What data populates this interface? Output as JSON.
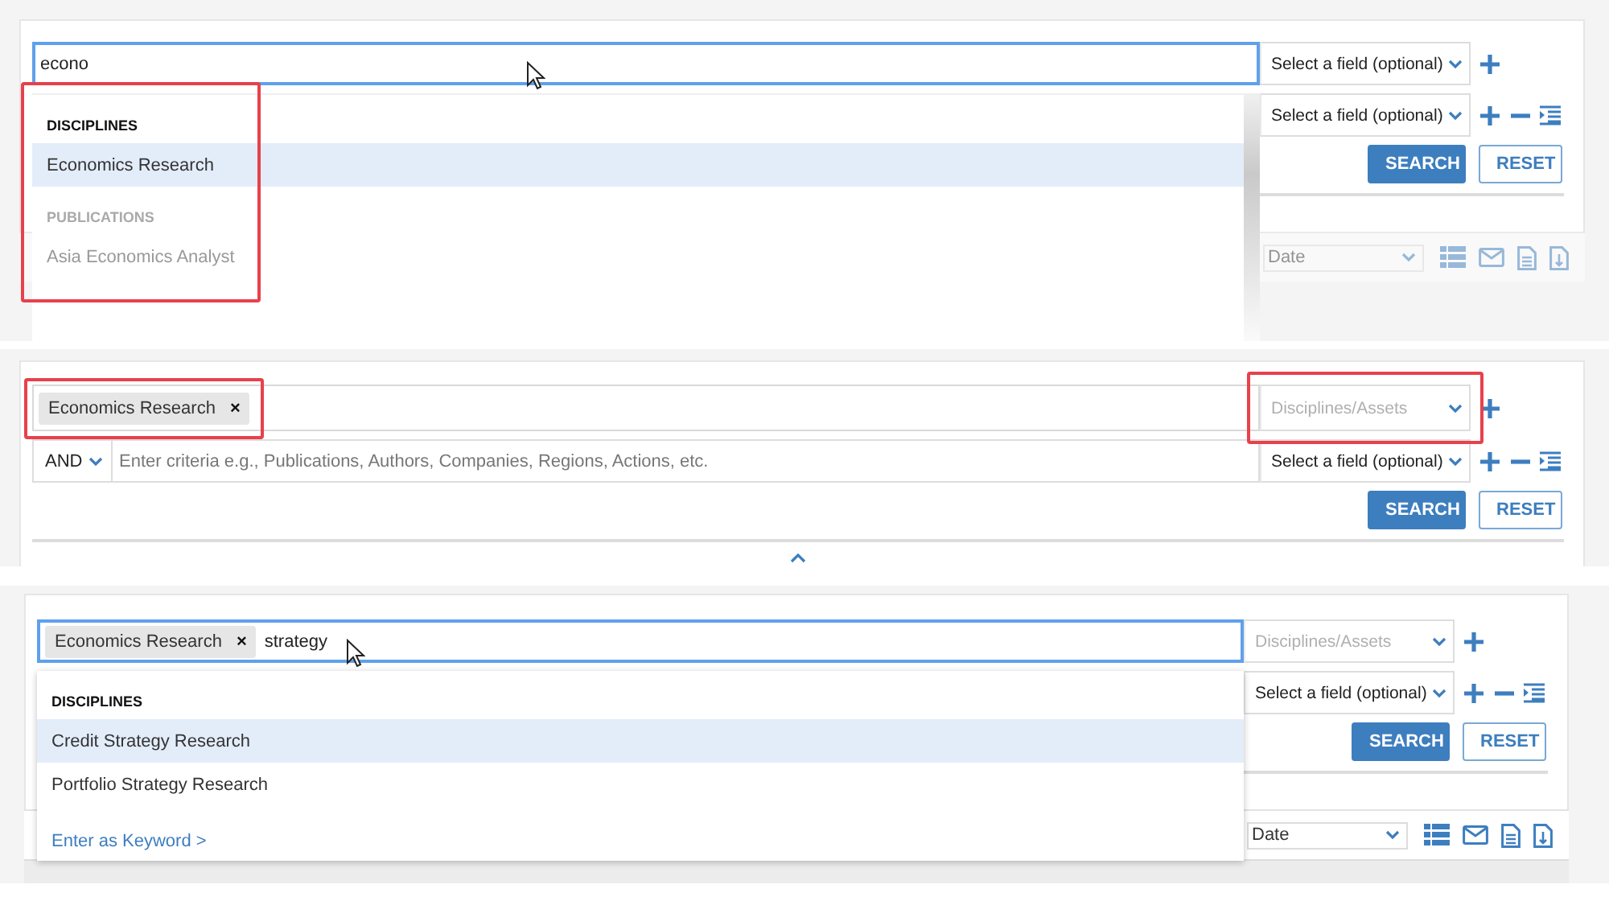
{
  "panels": [
    {
      "search_row": {
        "text": "econo",
        "focused": true,
        "field": {
          "label": "Select a field (optional)",
          "placeholder": false,
          "highlighted": false
        }
      },
      "criteria_row": {
        "field": {
          "label": "Select a field (optional)",
          "placeholder": false,
          "highlighted": false
        }
      },
      "buttons": [
        {
          "label": "SEARCH",
          "kind": "primary"
        },
        {
          "label": "RESET",
          "kind": "secondary"
        }
      ],
      "toolbar": {
        "sort": "Date",
        "faded": true
      },
      "suggestions": {
        "highlighted": true,
        "scrollable": true,
        "groups": [
          {
            "heading": "DISCIPLINES",
            "faded": false,
            "items": [
              {
                "label": "Economics Research",
                "selected": true
              }
            ]
          },
          {
            "heading": "PUBLICATIONS",
            "faded": true,
            "items": [
              {
                "label": "Asia Economics Analyst",
                "selected": false
              }
            ]
          }
        ]
      }
    },
    {
      "search_row": {
        "tokens": [
          {
            "label": "Economics Research",
            "remove": "×",
            "highlighted": true
          }
        ],
        "focused": false,
        "field": {
          "label": "Disciplines/Assets",
          "placeholder": true,
          "highlighted": true
        }
      },
      "criteria_row": {
        "operator": "AND",
        "placeholder": "Enter criteria e.g., Publications, Authors, Companies, Regions, Actions, etc.",
        "field": {
          "label": "Select a field (optional)",
          "placeholder": false,
          "highlighted": false
        }
      },
      "buttons": [
        {
          "label": "SEARCH",
          "kind": "primary"
        },
        {
          "label": "RESET",
          "kind": "secondary"
        }
      ],
      "collapse_toggle": true
    },
    {
      "search_row": {
        "tokens": [
          {
            "label": "Economics Research",
            "remove": "×",
            "highlighted": false
          }
        ],
        "text": "strategy",
        "focused": true,
        "field": {
          "label": "Disciplines/Assets",
          "placeholder": true,
          "highlighted": false
        }
      },
      "criteria_row": {
        "field": {
          "label": "Select a field (optional)",
          "placeholder": false,
          "highlighted": false
        }
      },
      "buttons": [
        {
          "label": "SEARCH",
          "kind": "primary"
        },
        {
          "label": "RESET",
          "kind": "secondary"
        }
      ],
      "toolbar": {
        "sort": "Date",
        "faded": false
      },
      "results_header": true,
      "suggestions": {
        "highlighted": false,
        "scrollable": false,
        "groups": [
          {
            "heading": "DISCIPLINES",
            "faded": false,
            "items": [
              {
                "label": "Credit Strategy Research",
                "selected": true
              },
              {
                "label": "Portfolio Strategy Research",
                "selected": false
              }
            ]
          }
        ],
        "keyword_link": "Enter as Keyword >"
      }
    }
  ]
}
